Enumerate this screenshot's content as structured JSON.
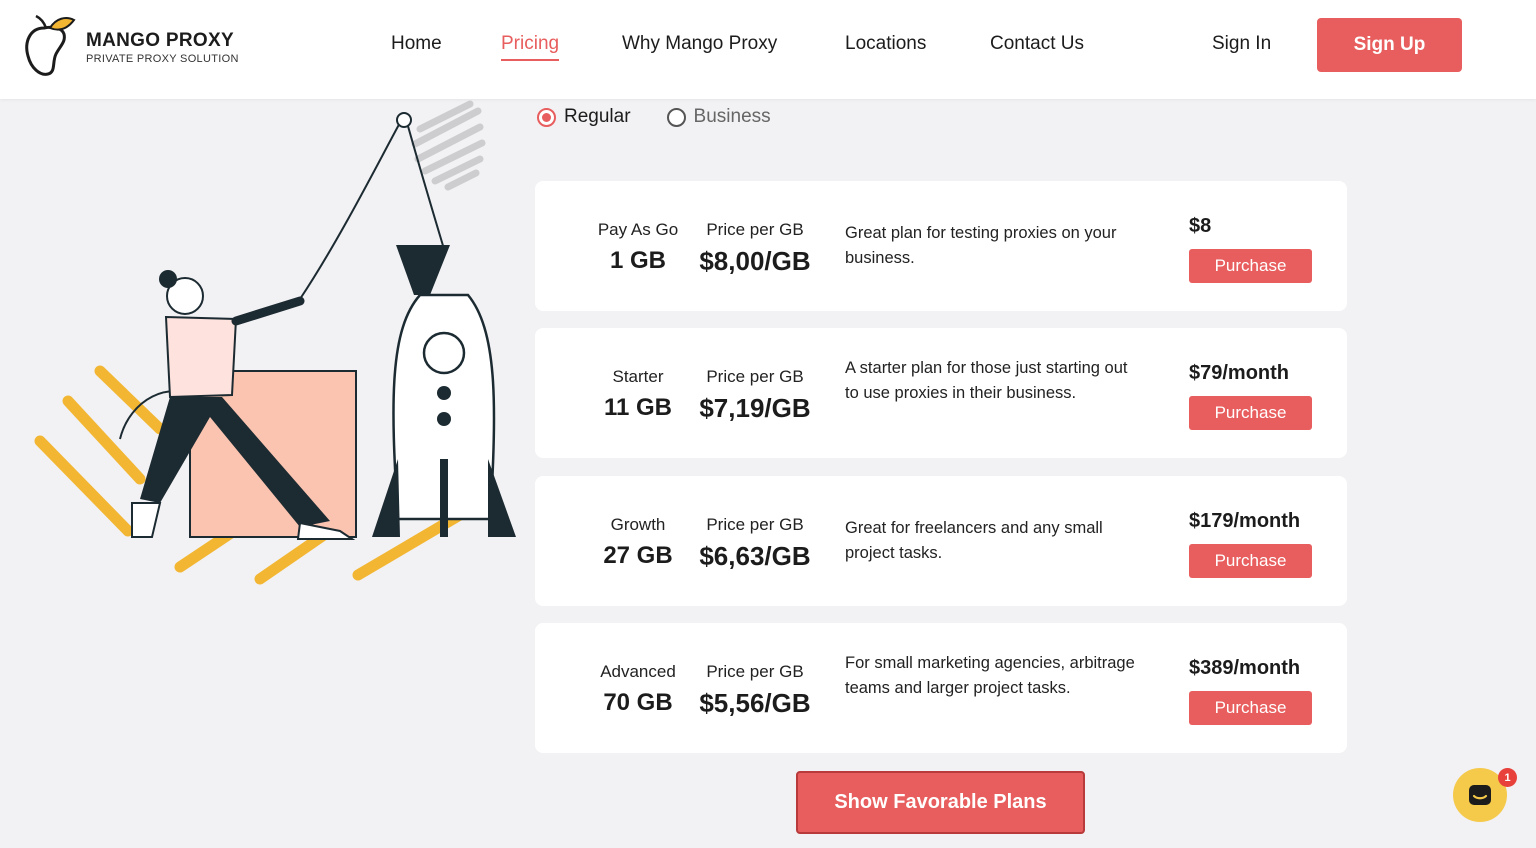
{
  "brand": {
    "title": "MANGO PROXY",
    "subtitle": "PRIVATE PROXY SOLUTION"
  },
  "nav": {
    "items": [
      {
        "label": "Home"
      },
      {
        "label": "Pricing",
        "active": true
      },
      {
        "label": "Why Mango Proxy"
      },
      {
        "label": "Locations"
      },
      {
        "label": "Contact Us"
      }
    ],
    "sign_in": "Sign In",
    "sign_up": "Sign Up"
  },
  "plan_type": {
    "options": [
      {
        "label": "Regular",
        "checked": true
      },
      {
        "label": "Business",
        "checked": false
      }
    ]
  },
  "plans": [
    {
      "name": "Pay As Go",
      "gb": "1 GB",
      "price_label": "Price per GB",
      "price": "$8,00/GB",
      "description": "Great plan for testing proxies on your business.",
      "cost": "$8",
      "button": "Purchase"
    },
    {
      "name": "Starter",
      "gb": "11 GB",
      "price_label": "Price per GB",
      "price": "$7,19/GB",
      "description": "A starter plan for those just starting out to use proxies in their business.",
      "cost": "$79/month",
      "button": "Purchase"
    },
    {
      "name": "Growth",
      "gb": "27 GB",
      "price_label": "Price per GB",
      "price": "$6,63/GB",
      "description": "Great for freelancers and any small project tasks.",
      "cost": "$179/month",
      "button": "Purchase"
    },
    {
      "name": "Advanced",
      "gb": "70 GB",
      "price_label": "Price per GB",
      "price": "$5,56/GB",
      "description": "For small marketing agencies, arbitrage teams and larger project tasks.",
      "cost": "$389/month",
      "button": "Purchase"
    }
  ],
  "show_plans_button": "Show Favorable Plans",
  "chat": {
    "badge": "1",
    "icon": "chat-icon"
  },
  "colors": {
    "accent": "#e85d5d",
    "background": "#f2f1f3",
    "chat": "#f5c94a"
  }
}
